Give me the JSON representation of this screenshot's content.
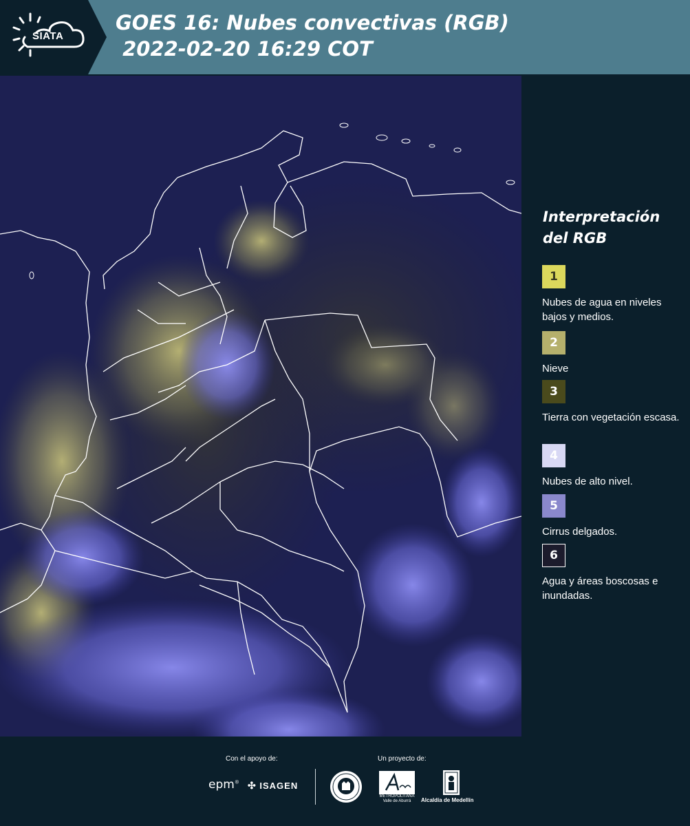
{
  "header": {
    "logo_text": "SIATA",
    "title_line1": "GOES 16: Nubes convectivas (RGB)",
    "title_line2": " 2022-02-20 16:29 COT",
    "colors": {
      "header_bg": "#4e7d8e",
      "logo_bg": "#0b1f2b"
    }
  },
  "map": {
    "description_icon": "satellite-rgb-map",
    "colors": {
      "background": "#1e2150",
      "cloud_high": "#6f6fe0",
      "cloud_low": "#d8d27a",
      "borders": "#ffffff"
    }
  },
  "legend": {
    "title": "Interpretación del RGB",
    "items": [
      {
        "number": "1",
        "label": "Nubes de agua en niveles bajos y medios.",
        "color": "#dcd85c",
        "text_color": "#3a3a20"
      },
      {
        "number": "2",
        "label": "Nieve",
        "color": "#b5b06c",
        "text_color": "#ffffff"
      },
      {
        "number": "3",
        "label": "Tierra con vegetación escasa.",
        "color": "#4a4a1c",
        "text_color": "#ffffff"
      },
      {
        "number": "4",
        "label": "Nubes de alto nivel.",
        "color": "#d8d8f4",
        "text_color": "#ffffff"
      },
      {
        "number": "5",
        "label": "Cirrus delgados.",
        "color": "#8a88cc",
        "text_color": "#ffffff"
      },
      {
        "number": "6",
        "label": "Agua y áreas boscosas e inundadas.",
        "color": "#1c1b2c",
        "text_color": "#ffffff"
      }
    ]
  },
  "footer": {
    "support_label": "Con el apoyo de:",
    "project_label": "Un proyecto de:",
    "epm": "epm",
    "isagen": "ISAGEN",
    "area_small": "METROPOLITANA Valle de Aburrá",
    "alcaldia": "Alcaldía de Medellín"
  }
}
